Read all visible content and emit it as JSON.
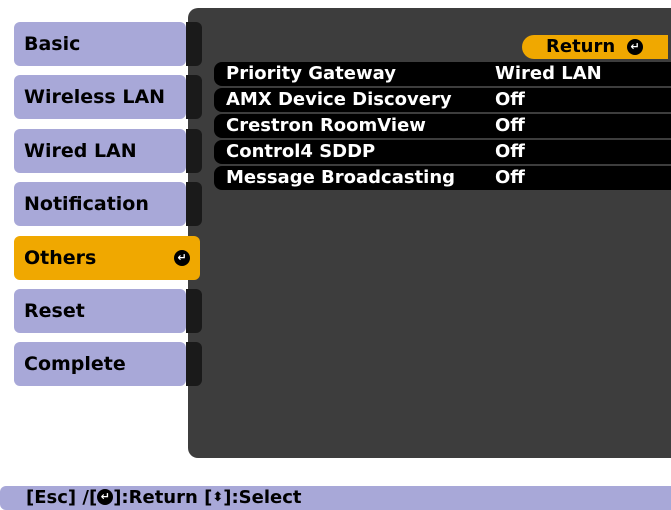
{
  "menu": {
    "items": [
      {
        "label": "Basic",
        "selected": false
      },
      {
        "label": "Wireless LAN",
        "selected": false
      },
      {
        "label": "Wired LAN",
        "selected": false
      },
      {
        "label": "Notification",
        "selected": false
      },
      {
        "label": "Others",
        "selected": true
      },
      {
        "label": "Reset",
        "selected": false
      },
      {
        "label": "Complete",
        "selected": false
      }
    ]
  },
  "return_button": {
    "label": "Return"
  },
  "settings": [
    {
      "name": "Priority Gateway",
      "value": "Wired LAN"
    },
    {
      "name": "AMX Device Discovery",
      "value": "Off"
    },
    {
      "name": "Crestron RoomView",
      "value": "Off"
    },
    {
      "name": "Control4 SDDP",
      "value": "Off"
    },
    {
      "name": "Message Broadcasting",
      "value": "Off"
    }
  ],
  "status_bar": {
    "esc_part": "[Esc] /[",
    "return_part": "]:Return  [",
    "select_part": "]:Select"
  },
  "icons": {
    "enter": "enter-icon",
    "updown": "up-down-arrow-icon"
  },
  "colors": {
    "menu_item": "#a8a8d8",
    "selected": "#f0a800",
    "panel": "#3d3d3d",
    "row": "#000000",
    "status_bar": "#a8a8d8"
  }
}
